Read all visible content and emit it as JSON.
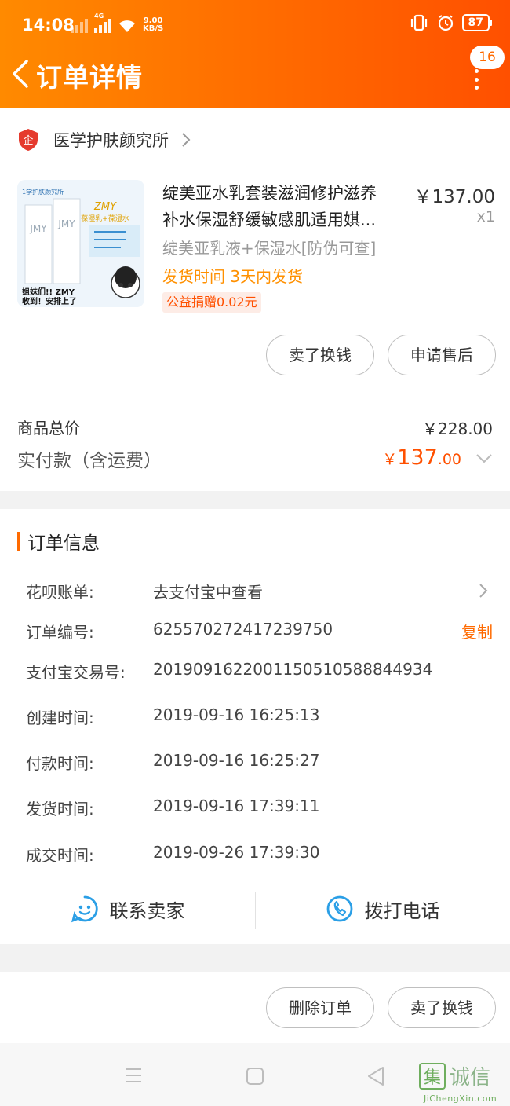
{
  "status_bar": {
    "time": "14:08",
    "net_speed_value": "9.00",
    "net_speed_unit": "KB/S",
    "net_type": "4G",
    "battery": "87"
  },
  "nav": {
    "title": "订单详情",
    "badge_count": "16"
  },
  "shop": {
    "name": "医学护肤颜究所",
    "badge_glyph": "企"
  },
  "product": {
    "title_line1": "绽美亚水乳套装滋润修护滋养",
    "title_line2": "补水保湿舒缓敏感肌适用娸...",
    "price": "￥137.00",
    "qty": "x1",
    "sku": "绽美亚乳液+保湿水[防伪可查]",
    "shipping": "发货时间 3天内发货",
    "charity": "公益捐赠0.02元",
    "image_text": {
      "zmy": "ZMY",
      "sub": "葆湿乳+葆湿水",
      "caption1": "姐妹们!! ZMY",
      "caption2": "收到！安排上了"
    }
  },
  "item_actions": {
    "sell": "卖了换钱",
    "after_sale": "申请售后"
  },
  "summary": {
    "total_label": "商品总价",
    "total_value": "￥228.00",
    "paid_label": "实付款（含运费）",
    "paid_currency": "￥",
    "paid_int": "137",
    "paid_dec": ".00"
  },
  "order_info": {
    "title": "订单信息",
    "rows": [
      {
        "key": "花呗账单:",
        "value": "去支付宝中查看"
      },
      {
        "key": "订单编号:",
        "value": "625570272417239750",
        "action": "复制"
      },
      {
        "key": "支付宝交易号:",
        "value": "2019091622001150510588844934"
      },
      {
        "key": "创建时间:",
        "value": "2019-09-16 16:25:13"
      },
      {
        "key": "付款时间:",
        "value": "2019-09-16 16:25:27"
      },
      {
        "key": "发货时间:",
        "value": "2019-09-16 17:39:11"
      },
      {
        "key": "成交时间:",
        "value": "2019-09-26 17:39:30"
      }
    ],
    "contact_seller": "联系卖家",
    "call_phone": "拨打电话"
  },
  "bottom_actions": {
    "delete_order": "删除订单",
    "sell": "卖了换钱"
  },
  "watermark": {
    "text": "集诚信",
    "url_text": "JiChengXin.com"
  },
  "colors": {
    "accent": "#ff6a00",
    "price_red": "#ff5000",
    "ship_orange": "#ff9000",
    "icon_blue": "#2b9fe6"
  }
}
